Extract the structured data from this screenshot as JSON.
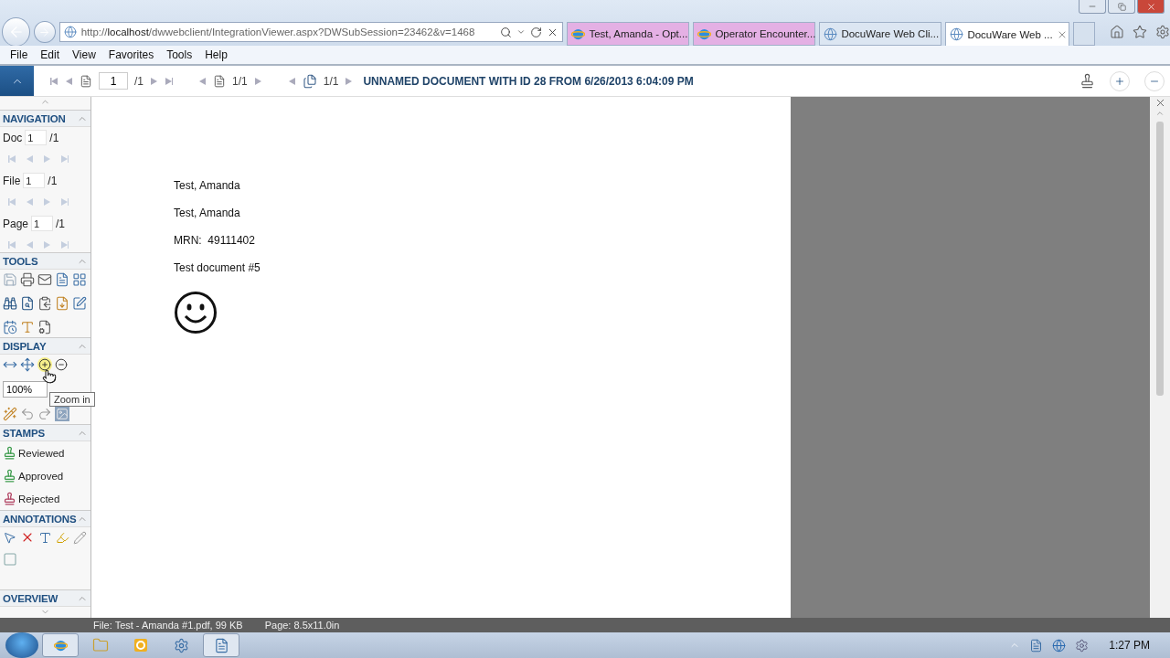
{
  "browser": {
    "address": "http://**localhost**/dwwebclient/IntegrationViewer.aspx?DWSubSession=23462&v=1468",
    "tabs": [
      {
        "label": "Test, Amanda - Opt...",
        "kind": "ie",
        "color": "#e4b0e4",
        "selected": false
      },
      {
        "label": "Operator Encounter...",
        "kind": "ie",
        "color": "#e4b0e4",
        "selected": false
      },
      {
        "label": "DocuWare Web Cli...",
        "kind": "globe",
        "color": "#dce6f2",
        "selected": false
      },
      {
        "label": "DocuWare Web ...",
        "kind": "globe",
        "color": "#ffffff",
        "selected": true
      }
    ],
    "menu": [
      "File",
      "Edit",
      "View",
      "Favorites",
      "Tools",
      "Help"
    ]
  },
  "toolbar": {
    "page_value": "1",
    "page_total": "/1",
    "file_count": "1/1",
    "doc_count": "1/1",
    "title": "UNNAMED DOCUMENT WITH ID 28 FROM 6/26/2013 6:04:09 PM"
  },
  "sidebar": {
    "navigation": {
      "title": "NAVIGATION",
      "rows": [
        {
          "label": "Doc",
          "value": "1",
          "total": "/1"
        },
        {
          "label": "File",
          "value": "1",
          "total": "/1"
        },
        {
          "label": "Page",
          "value": "1",
          "total": "/1"
        }
      ]
    },
    "tools": {
      "title": "TOOLS"
    },
    "display": {
      "title": "DISPLAY",
      "zoom": "100%",
      "tooltip": "Zoom in",
      "view_selected": true
    },
    "stamps": {
      "title": "STAMPS",
      "items": [
        {
          "label": "Reviewed",
          "color": "#3a9a4a"
        },
        {
          "label": "Approved",
          "color": "#3a9a4a"
        },
        {
          "label": "Rejected",
          "color": "#b04060"
        }
      ]
    },
    "annotations": {
      "title": "ANNOTATIONS"
    },
    "overview": {
      "title": "OVERVIEW"
    }
  },
  "document": {
    "lines": [
      "Test, Amanda",
      "Test, Amanda",
      "MRN:  49111402",
      "Test document #5"
    ]
  },
  "status_bar": {
    "file": "File: Test - Amanda #1.pdf, 99 KB",
    "page": "Page: 8.5x11.0in"
  },
  "taskbar": {
    "time": "1:27 PM"
  }
}
